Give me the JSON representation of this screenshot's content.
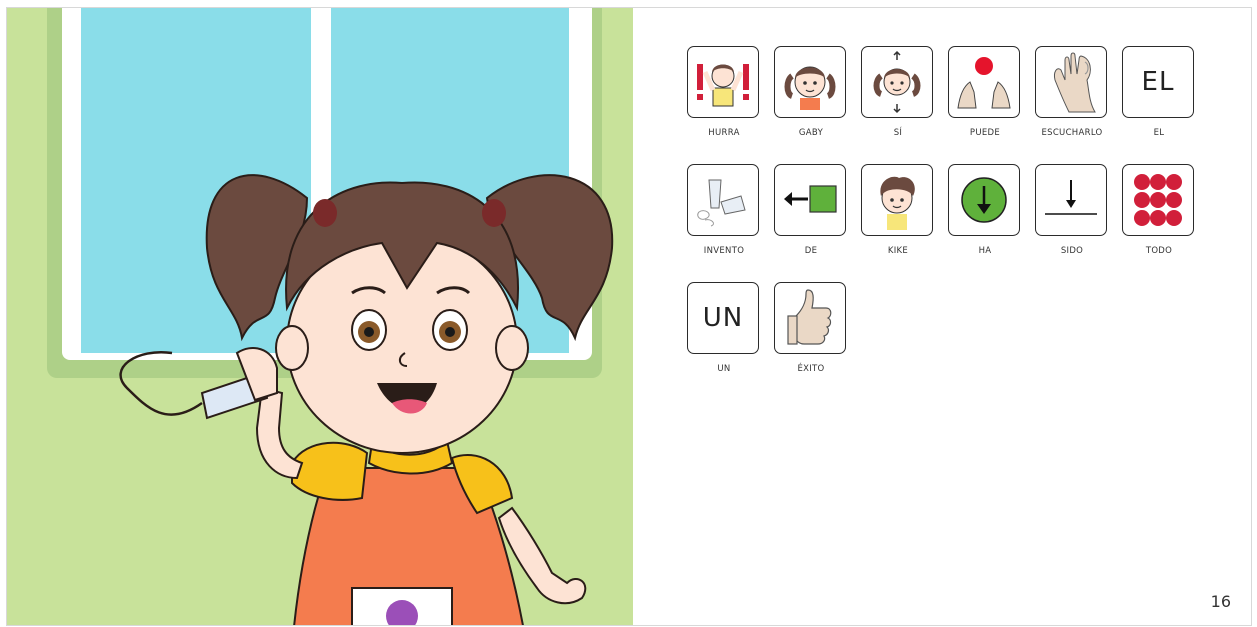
{
  "page": {
    "number": "16"
  },
  "illustration": {
    "subject": "girl-with-tin-can-phone",
    "colors": {
      "wall": "#c8e29a",
      "window": "#8adde9",
      "hair": "#6b4a3f",
      "dress": "#f47c4e",
      "sleeve": "#f7c11a"
    }
  },
  "pictograms": [
    {
      "label": "HURRA",
      "icon": "cheering-child-icon"
    },
    {
      "label": "GABY",
      "icon": "girl-face-icon"
    },
    {
      "label": "SÍ",
      "icon": "nodding-girl-icon"
    },
    {
      "label": "PUEDE",
      "icon": "hands-with-ball-icon"
    },
    {
      "label": "ESCUCHARLO",
      "icon": "hand-to-ear-icon"
    },
    {
      "label": "EL",
      "word": "EL"
    },
    {
      "label": "INVENTO",
      "icon": "tipped-cup-icon"
    },
    {
      "label": "DE",
      "icon": "arrow-from-square-icon"
    },
    {
      "label": "KIKE",
      "icon": "boy-face-icon"
    },
    {
      "label": "HA",
      "icon": "down-arrow-circle-icon"
    },
    {
      "label": "SIDO",
      "icon": "down-arrow-line-icon"
    },
    {
      "label": "TODO",
      "icon": "nine-dots-icon"
    },
    {
      "label": "UN",
      "word": "UN"
    },
    {
      "label": "ÉXITO",
      "icon": "thumbs-up-icon"
    }
  ]
}
